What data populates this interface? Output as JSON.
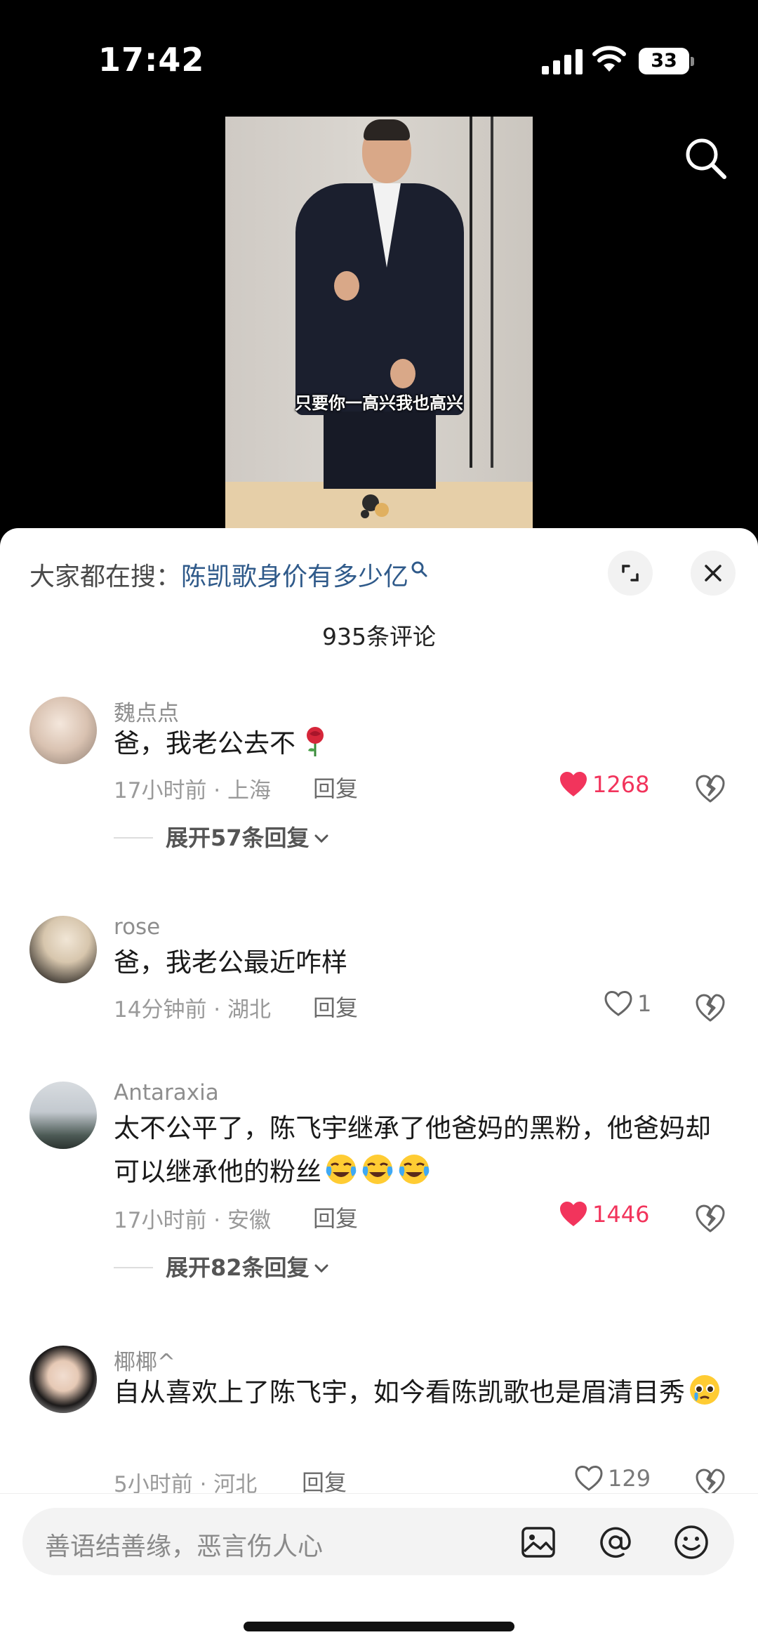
{
  "status_bar": {
    "time": "17:42",
    "battery": "33"
  },
  "video": {
    "subtitle": "只要你一高兴我也高兴"
  },
  "hot_search": {
    "prefix": "大家都在搜：",
    "query": "陈凯歌身价有多少亿"
  },
  "comments_count": "935条评论",
  "comments": [
    {
      "username": "魏点点",
      "text": "爸，我老公去不",
      "meta": "17小时前 · 上海",
      "reply": "回复",
      "likes": "1268",
      "liked": true,
      "expand": "展开57条回复"
    },
    {
      "username": "rose",
      "text": "爸，我老公最近咋样",
      "meta": "14分钟前 · 湖北",
      "reply": "回复",
      "likes": "1",
      "liked": false
    },
    {
      "username": "Antaraxia",
      "text": "太不公平了，陈飞宇继承了他爸妈的黑粉，他爸妈却可以继承他的粉丝",
      "meta": "17小时前 · 安徽",
      "reply": "回复",
      "likes": "1446",
      "liked": true,
      "expand": "展开82条回复"
    },
    {
      "username": "椰椰^",
      "text": "自从喜欢上了陈飞宇，如今看陈凯歌也是眉清目秀",
      "meta": "5小时前 · 河北",
      "reply": "回复",
      "likes": "129",
      "liked": false
    }
  ],
  "input": {
    "placeholder": "善语结善缘，恶言伤人心"
  },
  "colors": {
    "like_active": "#f2345c",
    "query_link": "#2f5a8a"
  }
}
